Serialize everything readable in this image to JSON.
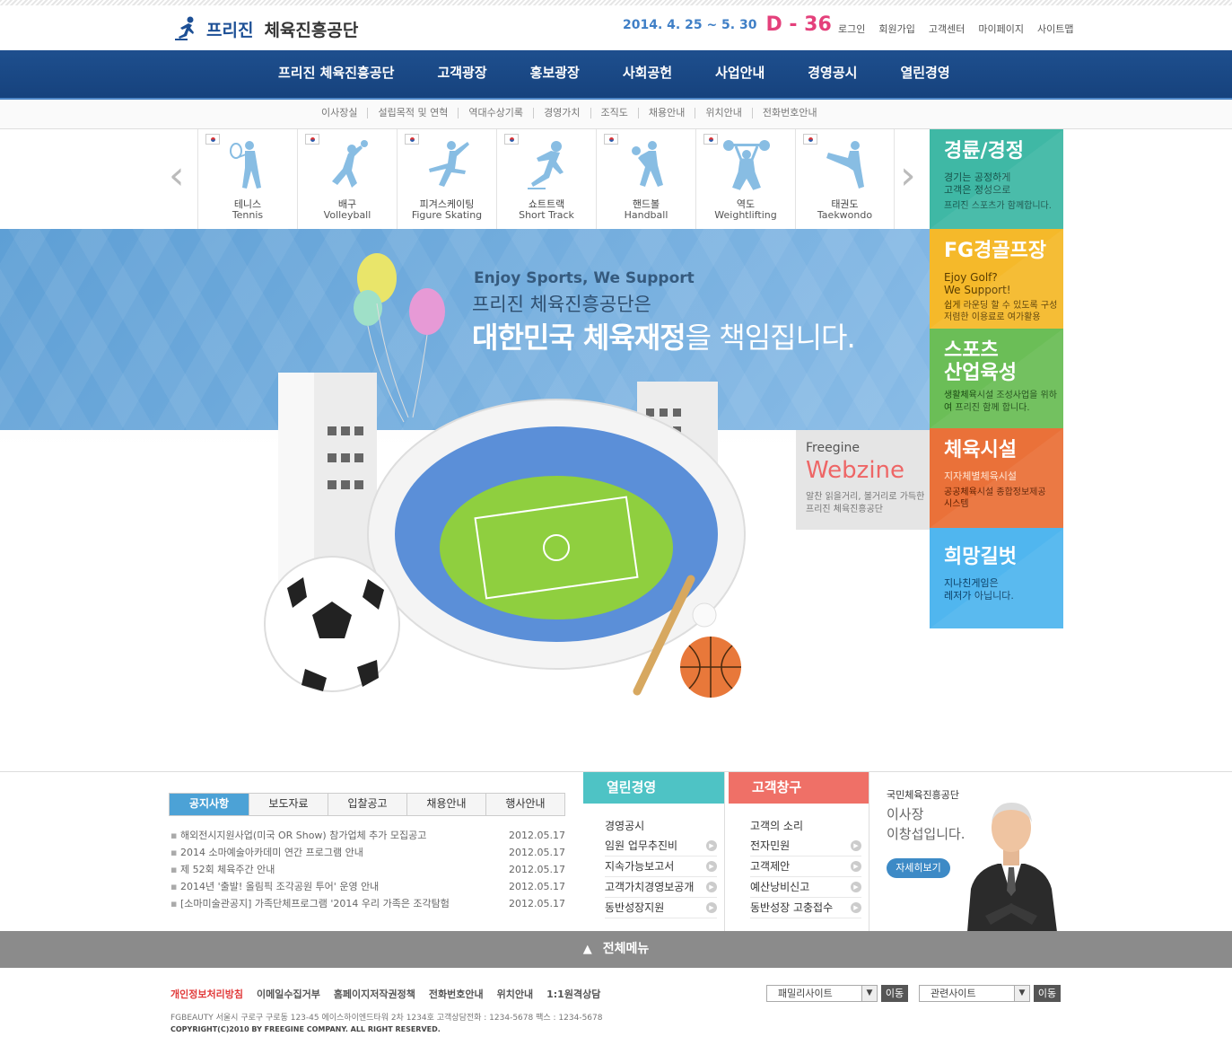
{
  "header": {
    "logo_brand": "프리진",
    "logo_name": "체육진흥공단",
    "event_date": "2014. 4. 25 ~ 5. 30",
    "dday": "D - 36",
    "util_links": [
      "로그인",
      "회원가입",
      "고객센터",
      "마이페이지",
      "사이트맵"
    ]
  },
  "gnb": [
    "프리진 체육진흥공단",
    "고객광장",
    "홍보광장",
    "사회공헌",
    "사업안내",
    "경영공시",
    "열린경영"
  ],
  "subnav": [
    "이사장실",
    "설립목적 및 연혁",
    "역대수상기록",
    "경영가치",
    "조직도",
    "채용안내",
    "위치안내",
    "전화번호안내"
  ],
  "sports": [
    {
      "kr": "테니스",
      "en": "Tennis",
      "icon": "tennis-icon"
    },
    {
      "kr": "배구",
      "en": "Volleyball",
      "icon": "volleyball-icon"
    },
    {
      "kr": "피겨스케이팅",
      "en": "Figure Skating",
      "icon": "figure-skating-icon"
    },
    {
      "kr": "쇼트트랙",
      "en": "Short Track",
      "icon": "short-track-icon"
    },
    {
      "kr": "핸드볼",
      "en": "Handball",
      "icon": "handball-icon"
    },
    {
      "kr": "역도",
      "en": "Weightlifting",
      "icon": "weightlifting-icon"
    },
    {
      "kr": "태권도",
      "en": "Taekwondo",
      "icon": "taekwondo-icon"
    }
  ],
  "hero": {
    "en": "Enjoy Sports, We Support",
    "kr1": "프리진 체육진흥공단은",
    "kr2_bold": "대한민국 체육재정",
    "kr2_light": "을 책임집니다."
  },
  "webzine": {
    "t1": "Freegine",
    "t2": "Webzine",
    "t3a": "알찬 읽을거리, 볼거리로 가득한",
    "t3b": "프리진 체육진흥공단"
  },
  "panels": [
    {
      "title": "경륜/경정",
      "d1": "경기는 공정하게",
      "d2": "고객은 정성으로",
      "d3": "프리진 스포츠가 함께합니다."
    },
    {
      "title": "FG경골프장",
      "d1": "Ejoy Golf?",
      "d2": "We Support!",
      "d3": "쉽게 라운딩 할 수 있도록 구성",
      "d4": "저렴한 이용료로 여가활용"
    },
    {
      "title": "스포츠",
      "title2": "산업육성",
      "d1": "생활체육시설 조성사업을 위하",
      "d2": "여 프리진 함께 합니다."
    },
    {
      "title": "체육시설",
      "d1": "지자체별체육시설",
      "d2": "공공체육시설 종합정보제공",
      "d3": "시스템"
    },
    {
      "title": "희망길벗",
      "d1": "지나친게임은",
      "d2": "레저가 아닙니다."
    }
  ],
  "notice": {
    "tabs": [
      "공지사항",
      "보도자료",
      "입찰공고",
      "채용안내",
      "행사안내"
    ],
    "items": [
      {
        "title": "해외전시지원사업(미국 OR Show) 참가업체 추가 모집공고",
        "date": "2012.05.17"
      },
      {
        "title": "2014 소마예술아카데미 연간 프로그램 안내",
        "date": "2012.05.17"
      },
      {
        "title": "제 52회 체육주간 안내",
        "date": "2012.05.17"
      },
      {
        "title": "2014년 '출발! 올림픽 조각공원 투어' 운영 안내",
        "date": "2012.05.17"
      },
      {
        "title": "[소마미술관공지] 가족단체프로그램 '2014 우리 가족은 조각탐험",
        "date": "2012.05.17"
      }
    ]
  },
  "open": {
    "title": "열린경영",
    "items": [
      "경영공시",
      "임원 업무추진비",
      "지속가능보고서",
      "고객가치경영보공개",
      "동반성장지원"
    ]
  },
  "customer": {
    "title": "고객창구",
    "items": [
      "고객의 소리",
      "전자민원",
      "고객제안",
      "예산낭비신고",
      "동반성장 고충접수"
    ]
  },
  "ceo": {
    "org": "국민체육진흥공단",
    "line1": "이사장",
    "line2": "이창섭입니다.",
    "button": "자세히보기"
  },
  "allmenu": "전체메뉴",
  "footer": {
    "links": [
      "개인정보처리방침",
      "이메일수집거부",
      "홈페이지저작권정책",
      "전화번호안내",
      "위치안내",
      "1:1원격상담"
    ],
    "address": "FGBEAUTY 서울시 구로구 구로동 123-45 에이스하이엔드타워 2차 1234호   고객상담전화 : 1234-5678   팩스 : 1234-5678",
    "copyright": "COPYRIGHT(C)2010 BY FREEGINE COMPANY. ALL RIGHT RESERVED.",
    "family_select": "패밀리사이트",
    "related_select": "관련사이트",
    "go": "이동"
  }
}
